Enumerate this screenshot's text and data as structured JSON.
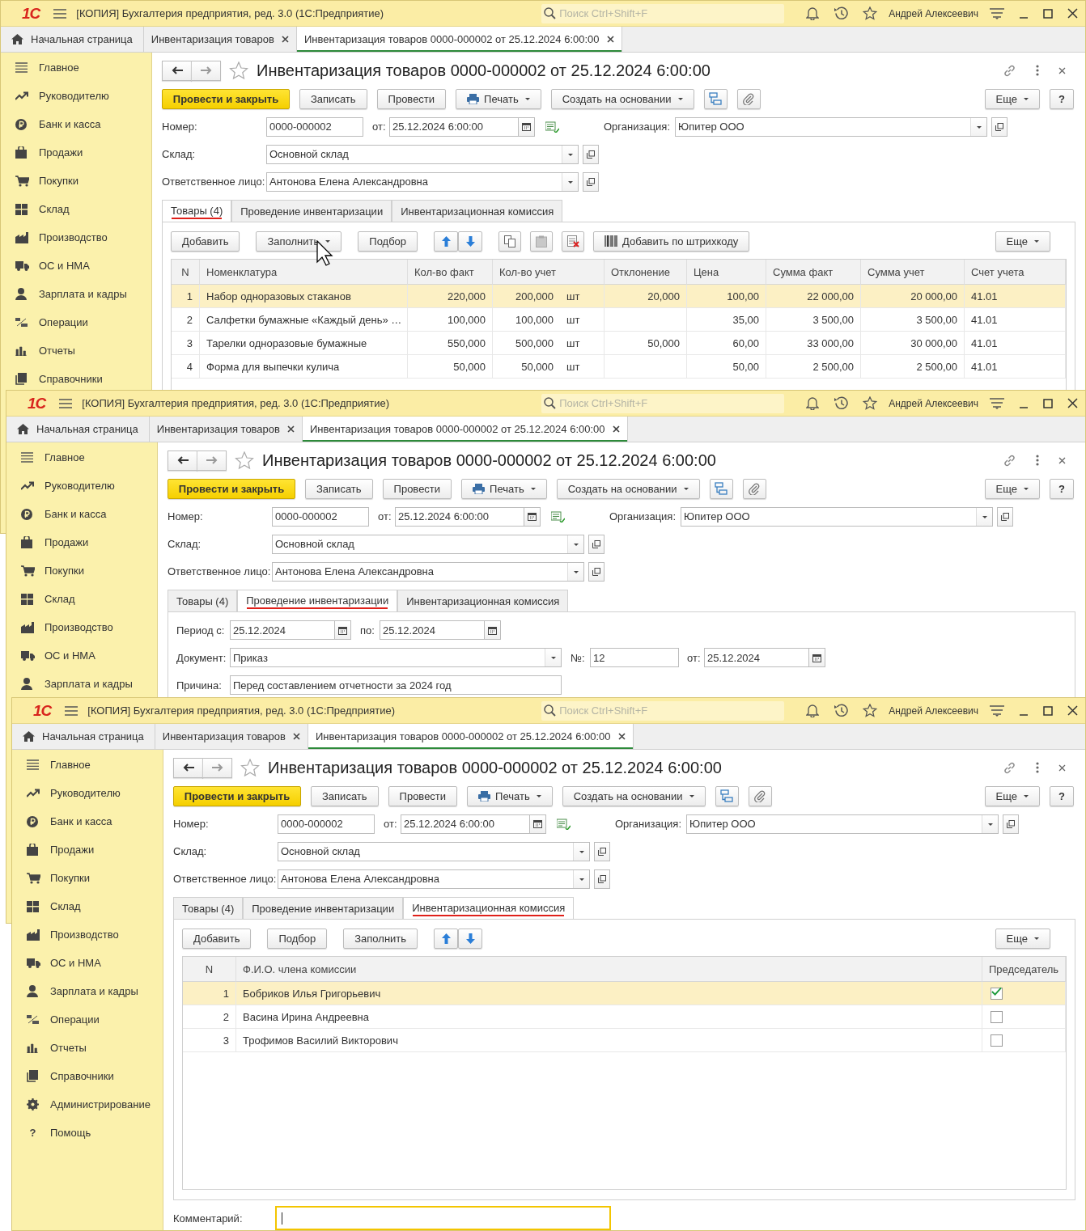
{
  "windows": [
    {
      "logo": "1С",
      "app_title": "[КОПИЯ] Бухгалтерия предприятия, ред. 3.0  (1С:Предприятие)",
      "search_placeholder": "Поиск Ctrl+Shift+F",
      "user": "Андрей Алексеевич",
      "open_tabs": [
        {
          "label": "Начальная страница",
          "kind": "home",
          "selected": false
        },
        {
          "label": "Инвентаризация товаров",
          "kind": "doc",
          "selected": false
        },
        {
          "label": "Инвентаризация товаров 0000-000002 от 25.12.2024 6:00:00",
          "kind": "doc",
          "selected": true
        }
      ],
      "sidebar": [
        {
          "label": "Главное"
        },
        {
          "label": "Руководителю"
        },
        {
          "label": "Банк и касса"
        },
        {
          "label": "Продажи"
        },
        {
          "label": "Покупки"
        },
        {
          "label": "Склад"
        },
        {
          "label": "Производство"
        },
        {
          "label": "ОС и НМА"
        },
        {
          "label": "Зарплата и кадры"
        },
        {
          "label": "Операции"
        },
        {
          "label": "Отчеты"
        },
        {
          "label": "Справочники"
        }
      ],
      "form": {
        "title": "Инвентаризация товаров 0000-000002 от 25.12.2024 6:00:00",
        "toolbar": [
          {
            "label": "Провести и закрыть",
            "kind": "primary"
          },
          {
            "label": "Записать",
            "kind": "plain"
          },
          {
            "label": "Провести",
            "kind": "plain"
          },
          {
            "label": "Печать",
            "kind": "print"
          },
          {
            "label": "Создать на основании",
            "kind": "dropdown"
          },
          {
            "kind": "structure"
          },
          {
            "kind": "attach"
          }
        ],
        "more": "Еще",
        "help": "?",
        "number": {
          "label": "Номер:",
          "value": "0000-000002"
        },
        "date": {
          "label": "от:",
          "value": "25.12.2024  6:00:00"
        },
        "org": {
          "label": "Организация:",
          "value": "Юпитер ООО"
        },
        "warehouse": {
          "label": "Склад:",
          "value": "Основной склад"
        },
        "person": {
          "label": "Ответственное лицо:",
          "value": "Антонова Елена Александровна"
        },
        "tabs": [
          {
            "label": "Товары (4)",
            "selected": true
          },
          {
            "label": "Проведение инвентаризации",
            "selected": false
          },
          {
            "label": "Инвентаризационная комиссия",
            "selected": false
          }
        ],
        "goods": {
          "add": "Добавить",
          "fill": "Заполнить",
          "pick": "Подбор",
          "barcode": "Добавить по штрихкоду",
          "more": "Еще",
          "columns": [
            "N",
            "Номенклатура",
            "Кол-во факт",
            "Кол-во учет",
            "Отклонение",
            "Цена",
            "Сумма факт",
            "Сумма учет",
            "Счет учета"
          ],
          "rows": [
            {
              "n": "1",
              "name": "Набор одноразовых стаканов",
              "fact": "220,000",
              "acc": "200,000",
              "unit": "шт",
              "dev": "20,000",
              "price": "100,00",
              "sum_fact": "22 000,00",
              "sum_acc": "20 000,00",
              "account": "41.01",
              "selected": true
            },
            {
              "n": "2",
              "name": "Салфетки бумажные «Каждый день» …",
              "fact": "100,000",
              "acc": "100,000",
              "unit": "шт",
              "price": "35,00",
              "sum_fact": "3 500,00",
              "sum_acc": "3 500,00",
              "account": "41.01",
              "selected": false
            },
            {
              "n": "3",
              "name": "Тарелки одноразовые бумажные",
              "fact": "550,000",
              "acc": "500,000",
              "unit": "шт",
              "dev": "50,000",
              "price": "60,00",
              "sum_fact": "33 000,00",
              "sum_acc": "30 000,00",
              "account": "41.01",
              "selected": false
            },
            {
              "n": "4",
              "name": "Форма для выпечки кулича",
              "fact": "50,000",
              "acc": "50,000",
              "unit": "шт",
              "price": "50,00",
              "sum_fact": "2 500,00",
              "sum_acc": "2 500,00",
              "account": "41.01",
              "selected": false
            }
          ]
        }
      }
    },
    {
      "logo": "1С",
      "app_title": "[КОПИЯ] Бухгалтерия предприятия, ред. 3.0  (1С:Предприятие)",
      "search_placeholder": "Поиск Ctrl+Shift+F",
      "user": "Андрей Алексеевич",
      "open_tabs": [
        {
          "label": "Начальная страница",
          "kind": "home",
          "selected": false
        },
        {
          "label": "Инвентаризация товаров",
          "kind": "doc",
          "selected": false
        },
        {
          "label": "Инвентаризация товаров 0000-000002 от 25.12.2024 6:00:00",
          "kind": "doc",
          "selected": true
        }
      ],
      "sidebar": [
        {
          "label": "Главное"
        },
        {
          "label": "Руководителю"
        },
        {
          "label": "Банк и касса"
        },
        {
          "label": "Продажи"
        },
        {
          "label": "Покупки"
        },
        {
          "label": "Склад"
        },
        {
          "label": "Производство"
        },
        {
          "label": "ОС и НМА"
        },
        {
          "label": "Зарплата и кадры"
        }
      ],
      "form": {
        "title": "Инвентаризация товаров 0000-000002 от 25.12.2024 6:00:00",
        "toolbar": [
          {
            "label": "Провести и закрыть",
            "kind": "primary"
          },
          {
            "label": "Записать",
            "kind": "plain"
          },
          {
            "label": "Провести",
            "kind": "plain"
          },
          {
            "label": "Печать",
            "kind": "print"
          },
          {
            "label": "Создать на основании",
            "kind": "dropdown"
          },
          {
            "kind": "structure"
          },
          {
            "kind": "attach"
          }
        ],
        "more": "Еще",
        "help": "?",
        "number": {
          "label": "Номер:",
          "value": "0000-000002"
        },
        "date": {
          "label": "от:",
          "value": "25.12.2024  6:00:00"
        },
        "org": {
          "label": "Организация:",
          "value": "Юпитер ООО"
        },
        "warehouse": {
          "label": "Склад:",
          "value": "Основной склад"
        },
        "person": {
          "label": "Ответственное лицо:",
          "value": "Антонова Елена Александровна"
        },
        "tabs": [
          {
            "label": "Товары (4)",
            "selected": false
          },
          {
            "label": "Проведение инвентаризации",
            "selected": true
          },
          {
            "label": "Инвентаризационная комиссия",
            "selected": false
          }
        ],
        "conduct": {
          "period_from": {
            "label": "Период с:",
            "value": "25.12.2024"
          },
          "period_to": {
            "label": "по:",
            "value": "25.12.2024"
          },
          "document": {
            "label": "Документ:",
            "value": "Приказ"
          },
          "doc_number": {
            "label": "№:",
            "value": "12"
          },
          "doc_date": {
            "label": "от:",
            "value": "25.12.2024"
          },
          "reason": {
            "label": "Причина:",
            "value": "Перед составлением отчетности за 2024 год"
          }
        }
      }
    },
    {
      "logo": "1С",
      "app_title": "[КОПИЯ] Бухгалтерия предприятия, ред. 3.0  (1С:Предприятие)",
      "search_placeholder": "Поиск Ctrl+Shift+F",
      "user": "Андрей Алексеевич",
      "open_tabs": [
        {
          "label": "Начальная страница",
          "kind": "home",
          "selected": false
        },
        {
          "label": "Инвентаризация товаров",
          "kind": "doc",
          "selected": false
        },
        {
          "label": "Инвентаризация товаров 0000-000002 от 25.12.2024 6:00:00",
          "kind": "doc",
          "selected": true
        }
      ],
      "sidebar": [
        {
          "label": "Главное"
        },
        {
          "label": "Руководителю"
        },
        {
          "label": "Банк и касса"
        },
        {
          "label": "Продажи"
        },
        {
          "label": "Покупки"
        },
        {
          "label": "Склад"
        },
        {
          "label": "Производство"
        },
        {
          "label": "ОС и НМА"
        },
        {
          "label": "Зарплата и кадры"
        },
        {
          "label": "Операции"
        },
        {
          "label": "Отчеты"
        },
        {
          "label": "Справочники"
        },
        {
          "label": "Администрирование"
        },
        {
          "label": "Помощь",
          "icon_char": "?"
        }
      ],
      "form": {
        "title": "Инвентаризация товаров 0000-000002 от 25.12.2024 6:00:00",
        "toolbar": [
          {
            "label": "Провести и закрыть",
            "kind": "primary"
          },
          {
            "label": "Записать",
            "kind": "plain"
          },
          {
            "label": "Провести",
            "kind": "plain"
          },
          {
            "label": "Печать",
            "kind": "print"
          },
          {
            "label": "Создать на основании",
            "kind": "dropdown"
          },
          {
            "kind": "structure"
          },
          {
            "kind": "attach"
          }
        ],
        "more": "Еще",
        "help": "?",
        "number": {
          "label": "Номер:",
          "value": "0000-000002"
        },
        "date": {
          "label": "от:",
          "value": "25.12.2024  6:00:00"
        },
        "org": {
          "label": "Организация:",
          "value": "Юпитер ООО"
        },
        "warehouse": {
          "label": "Склад:",
          "value": "Основной склад"
        },
        "person": {
          "label": "Ответственное лицо:",
          "value": "Антонова Елена Александровна"
        },
        "tabs": [
          {
            "label": "Товары (4)",
            "selected": false
          },
          {
            "label": "Проведение инвентаризации",
            "selected": false
          },
          {
            "label": "Инвентаризационная комиссия",
            "selected": true
          }
        ],
        "commission": {
          "add": "Добавить",
          "pick": "Подбор",
          "fill": "Заполнить",
          "more": "Еще",
          "columns": [
            "N",
            "Ф.И.О. члена комиссии",
            "Председатель"
          ],
          "rows": [
            {
              "n": "1",
              "name": "Бобриков Илья Григорьевич",
              "chairman": true,
              "selected": true
            },
            {
              "n": "2",
              "name": "Васина Ирина Андреевна",
              "chairman": false,
              "selected": false
            },
            {
              "n": "3",
              "name": "Трофимов Василий Викторович",
              "chairman": false,
              "selected": false
            }
          ],
          "comment": {
            "label": "Комментарий:",
            "focused": true
          }
        }
      }
    }
  ]
}
